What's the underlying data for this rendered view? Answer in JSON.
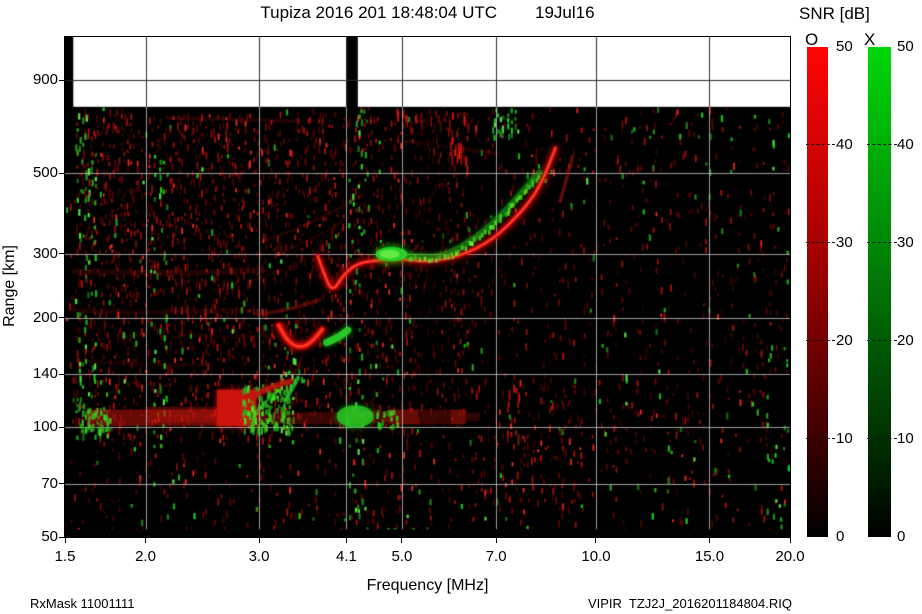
{
  "header": {
    "title": "Tupiza 2016 201 18:48:04 UTC",
    "date": "19Jul16"
  },
  "colorbar": {
    "title": "SNR [dB]",
    "o_label": "O",
    "x_label": "X",
    "ticks": [
      "50",
      "40",
      "30",
      "20",
      "10",
      "0"
    ],
    "min": 0,
    "max": 50,
    "o_top_color": "#ff0000",
    "x_top_color": "#00d80a",
    "bottom_color": "#000000"
  },
  "axes": {
    "xlabel": "Frequency [MHz]",
    "ylabel": "Range [km]",
    "x_tick_labels": [
      "1.5",
      "2.0",
      "3.0",
      "4.1",
      "5.0",
      "7.0",
      "10.0",
      "15.0",
      "20.0"
    ],
    "y_tick_labels": [
      "900",
      "500",
      "300",
      "200",
      "140",
      "100",
      "70",
      "50"
    ]
  },
  "footer": {
    "rx_mask": "RxMask 11001111",
    "file": "VIPIR  TZJ2J_2016201184804.RIQ"
  },
  "chart_data": {
    "type": "heatmap",
    "title": "Tupiza 2016 201 18:48:04 UTC  19Jul16",
    "xlabel": "Frequency [MHz]",
    "ylabel": "Range [km]",
    "x_scale": "log",
    "y_scale": "log",
    "xlim": [
      1.5,
      20
    ],
    "ylim": [
      50,
      1182
    ],
    "x_ticks": [
      1.5,
      2.0,
      3.0,
      4.1,
      5.0,
      7.0,
      10.0,
      15.0,
      20.0
    ],
    "y_ticks": [
      900,
      500,
      300,
      200,
      140,
      100,
      70,
      50
    ],
    "grid": true,
    "legend": "SNR [dB] 0-50: O-mode red colorbar, X-mode green colorbar",
    "data_top_km": 760,
    "bottom_strip_R": [
      50,
      52.5
    ],
    "o_trace": [
      [
        3.7,
        296
      ],
      [
        3.79,
        262
      ],
      [
        3.9,
        235
      ],
      [
        4.06,
        263
      ],
      [
        4.26,
        282
      ],
      [
        4.56,
        288
      ],
      [
        5.0,
        291
      ],
      [
        5.5,
        284
      ],
      [
        6.2,
        297
      ],
      [
        6.85,
        325
      ],
      [
        7.35,
        362
      ],
      [
        7.9,
        417
      ],
      [
        8.25,
        474
      ],
      [
        8.5,
        540
      ],
      [
        8.65,
        585
      ]
    ],
    "x_trace": [
      [
        5.1,
        297
      ],
      [
        5.55,
        292
      ],
      [
        5.95,
        302
      ],
      [
        6.4,
        325
      ],
      [
        6.9,
        362
      ],
      [
        7.3,
        400
      ],
      [
        7.65,
        440
      ],
      [
        7.95,
        475
      ],
      [
        8.18,
        502
      ]
    ],
    "green_blob": {
      "f": [
        4.55,
        5.1
      ],
      "R": [
        286,
        313
      ]
    },
    "cusp2_o": [
      [
        3.22,
        191
      ],
      [
        3.3,
        174
      ],
      [
        3.46,
        165
      ],
      [
        3.62,
        171
      ],
      [
        3.76,
        186
      ]
    ],
    "cusp2_x": [
      [
        3.82,
        171
      ],
      [
        3.97,
        176
      ],
      [
        4.12,
        185
      ]
    ],
    "cusp3_o": [
      [
        2.92,
        121
      ],
      [
        3.12,
        129
      ],
      [
        3.36,
        134
      ]
    ],
    "cusp3_x": [
      [
        3.3,
        119
      ],
      [
        3.38,
        128
      ],
      [
        3.45,
        137
      ]
    ],
    "o_echo_tip": [
      [
        8.8,
        418
      ],
      [
        9.0,
        480
      ],
      [
        9.2,
        555
      ]
    ],
    "o_echo_cusp2": [
      [
        3.0,
        204
      ],
      [
        3.35,
        211
      ],
      [
        3.72,
        224
      ]
    ],
    "faint_bands": [
      {
        "pts": [
          [
            1.55,
            268
          ],
          [
            2.2,
            264
          ],
          [
            3.05,
            270
          ]
        ],
        "w": 6,
        "a": 0.17
      },
      {
        "pts": [
          [
            1.55,
            210
          ],
          [
            2.1,
            206
          ],
          [
            2.85,
            211
          ]
        ],
        "w": 5,
        "a": 0.14
      },
      {
        "pts": [
          [
            3.05,
            325
          ],
          [
            3.7,
            370
          ],
          [
            4.35,
            437
          ]
        ],
        "w": 3,
        "a": 0.2
      },
      {
        "pts": [
          [
            3.2,
            298
          ],
          [
            3.75,
            338
          ],
          [
            4.15,
            380
          ]
        ],
        "w": 3,
        "a": 0.15
      },
      {
        "pts": [
          [
            2.9,
            252
          ],
          [
            3.4,
            278
          ],
          [
            3.65,
            300
          ]
        ],
        "w": 3,
        "a": 0.12
      },
      {
        "pts": [
          [
            2.15,
            710
          ],
          [
            2.8,
            700
          ],
          [
            3.45,
            694
          ]
        ],
        "w": 4,
        "a": 0.2
      },
      {
        "pts": [
          [
            5.05,
            612
          ],
          [
            6.0,
            585
          ],
          [
            7.05,
            566
          ]
        ],
        "w": 4,
        "a": 0.18
      },
      {
        "pts": [
          [
            1.6,
            152
          ],
          [
            2.05,
            148
          ],
          [
            2.5,
            149
          ]
        ],
        "w": 4,
        "a": 0.12
      },
      {
        "pts": [
          [
            2.3,
            180
          ],
          [
            2.75,
            176
          ],
          [
            3.1,
            179
          ]
        ],
        "w": 4,
        "a": 0.1
      }
    ],
    "e_layer": {
      "red": [
        {
          "f": [
            1.62,
            3.02
          ],
          "R": [
            101,
            112
          ],
          "a": 0.5
        },
        {
          "f": [
            2.0,
            2.6
          ],
          "R": [
            103,
            114
          ],
          "a": 0.35
        },
        {
          "f": [
            2.58,
            2.97
          ],
          "R": [
            101,
            127
          ],
          "a": 0.92,
          "glow": true
        },
        {
          "f": [
            3.0,
            4.05
          ],
          "R": [
            102,
            110
          ],
          "a": 0.28
        },
        {
          "f": [
            4.1,
            4.8
          ],
          "R": [
            103,
            111
          ],
          "a": 0.35
        },
        {
          "f": [
            4.8,
            6.28
          ],
          "R": [
            102,
            112
          ],
          "a": 0.5
        },
        {
          "f": [
            6.28,
            6.6
          ],
          "R": [
            104,
            110
          ],
          "a": 0.22
        }
      ],
      "green": [
        {
          "f": [
            3.96,
            4.52
          ],
          "R": [
            100,
            115
          ],
          "a": 0.8,
          "style": "blob"
        },
        {
          "f": [
            2.82,
            3.34
          ],
          "R": [
            99,
            130
          ],
          "a": 0.7,
          "style": "dashes"
        },
        {
          "f": [
            1.58,
            1.76
          ],
          "R": [
            98,
            114
          ],
          "a": 0.7,
          "style": "dashes"
        },
        {
          "f": [
            4.55,
            4.9
          ],
          "R": [
            100,
            112
          ],
          "a": 0.5,
          "style": "dashes"
        }
      ]
    },
    "rfi_black_columns": [
      {
        "f": [
          1.5,
          1.545
        ]
      },
      {
        "f": [
          4.1,
          4.27
        ]
      }
    ],
    "rfi_dark_columns": [
      {
        "f": [
          5.3,
          5.95
        ],
        "R": [
          95,
          755
        ],
        "a": 0.45
      }
    ],
    "noise": {
      "red": [
        {
          "f": [
            1.5,
            20
          ],
          "R": [
            50,
            760
          ],
          "d": 0.06
        },
        {
          "f": [
            1.55,
            6.3
          ],
          "R": [
            100,
            745
          ],
          "d": 0.22
        },
        {
          "f": [
            1.55,
            3.3
          ],
          "R": [
            240,
            745
          ],
          "d": 0.3
        },
        {
          "f": [
            1.55,
            3.1
          ],
          "R": [
            95,
            240
          ],
          "d": 0.26
        },
        {
          "f": [
            6.4,
            9.6
          ],
          "R": [
            58,
            140
          ],
          "d": 0.16
        },
        {
          "f": [
            6.3,
            20
          ],
          "R": [
            95,
            600
          ],
          "d": 0.075
        },
        {
          "f": [
            1.5,
            6.3
          ],
          "R": [
            56,
            100
          ],
          "d": 0.09
        },
        {
          "f": [
            9.0,
            20
          ],
          "R": [
            600,
            760
          ],
          "d": 0.05
        },
        {
          "f": [
            9.6,
            20
          ],
          "R": [
            50,
            95
          ],
          "d": 0.04
        }
      ],
      "red_bright": [
        {
          "f": [
            5.85,
            6.35
          ],
          "R": [
            520,
            720
          ],
          "d": 0.3
        },
        {
          "f": [
            4.9,
            6.3
          ],
          "R": [
            690,
            755
          ],
          "d": 0.25
        },
        {
          "f": [
            7.2,
            7.7
          ],
          "R": [
            95,
            135
          ],
          "d": 0.2
        }
      ],
      "green": [
        {
          "f": [
            1.5,
            20
          ],
          "R": [
            52,
            755
          ],
          "d": 0.012
        },
        {
          "f": [
            1.56,
            1.68
          ],
          "R": [
            95,
            745
          ],
          "d": 0.14
        },
        {
          "f": [
            2.04,
            2.17
          ],
          "R": [
            90,
            700
          ],
          "d": 0.11
        },
        {
          "f": [
            4.12,
            4.34
          ],
          "R": [
            55,
            755
          ],
          "d": 0.14
        },
        {
          "f": [
            4.34,
            4.6
          ],
          "R": [
            55,
            755
          ],
          "d": 0.03
        },
        {
          "f": [
            6.9,
            7.5
          ],
          "R": [
            630,
            755
          ],
          "d": 0.45
        },
        {
          "f": [
            12.5,
            20
          ],
          "R": [
            580,
            750
          ],
          "d": 0.05
        },
        {
          "f": [
            18.3,
            20
          ],
          "R": [
            55,
            170
          ],
          "d": 0.08
        },
        {
          "f": [
            2.8,
            3.4
          ],
          "R": [
            98,
            132
          ],
          "d": 0.4
        },
        {
          "f": [
            1.58,
            1.76
          ],
          "R": [
            96,
            116
          ],
          "d": 0.4
        },
        {
          "f": [
            3.2,
            3.6
          ],
          "R": [
            135,
            165
          ],
          "d": 0.15
        },
        {
          "f": [
            1.5,
            20
          ],
          "R": [
            50,
            58
          ],
          "d": 0.02
        }
      ]
    }
  }
}
